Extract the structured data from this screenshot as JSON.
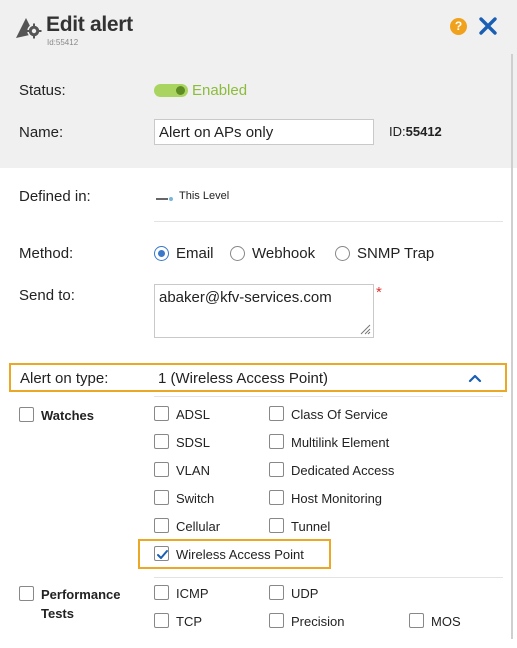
{
  "header": {
    "title": "Edit alert",
    "subtitle_id": "Id:55412",
    "help_label": "?"
  },
  "status": {
    "label": "Status:",
    "value": "Enabled",
    "enabled": true
  },
  "name": {
    "label": "Name:",
    "value": "Alert on APs only",
    "id_prefix": "ID:",
    "id_value": "55412"
  },
  "defined_in": {
    "label": "Defined in:",
    "value": "This Level"
  },
  "method": {
    "label": "Method:",
    "options": [
      "Email",
      "Webhook",
      "SNMP Trap"
    ],
    "selected": "Email"
  },
  "send_to": {
    "label": "Send to:",
    "value": "abaker@kfv-services.com",
    "required_mark": "*"
  },
  "alert_on_type": {
    "label": "Alert on type:",
    "value": "1 (Wireless Access Point)"
  },
  "groups": {
    "watches": {
      "label": "Watches",
      "checked": false,
      "items": [
        {
          "label": "ADSL",
          "checked": false
        },
        {
          "label": "Class Of Service",
          "checked": false
        },
        {
          "label": "SDSL",
          "checked": false
        },
        {
          "label": "Multilink Element",
          "checked": false
        },
        {
          "label": "VLAN",
          "checked": false
        },
        {
          "label": "Dedicated Access",
          "checked": false
        },
        {
          "label": "Switch",
          "checked": false
        },
        {
          "label": "Host Monitoring",
          "checked": false
        },
        {
          "label": "Cellular",
          "checked": false
        },
        {
          "label": "Tunnel",
          "checked": false
        },
        {
          "label": "Wireless Access Point",
          "checked": true
        }
      ]
    },
    "performance_tests": {
      "label_line1": "Performance",
      "label_line2": "Tests",
      "checked": false,
      "items": [
        {
          "label": "ICMP",
          "checked": false
        },
        {
          "label": "UDP",
          "checked": false
        },
        {
          "label": "TCP",
          "checked": false
        },
        {
          "label": "Precision",
          "checked": false
        },
        {
          "label": "MOS",
          "checked": false
        }
      ]
    }
  },
  "colors": {
    "accent_orange": "#eba827",
    "toggle_green": "#a9d460",
    "close_blue": "#1a5fb4",
    "radio_blue": "#3a78c9"
  }
}
